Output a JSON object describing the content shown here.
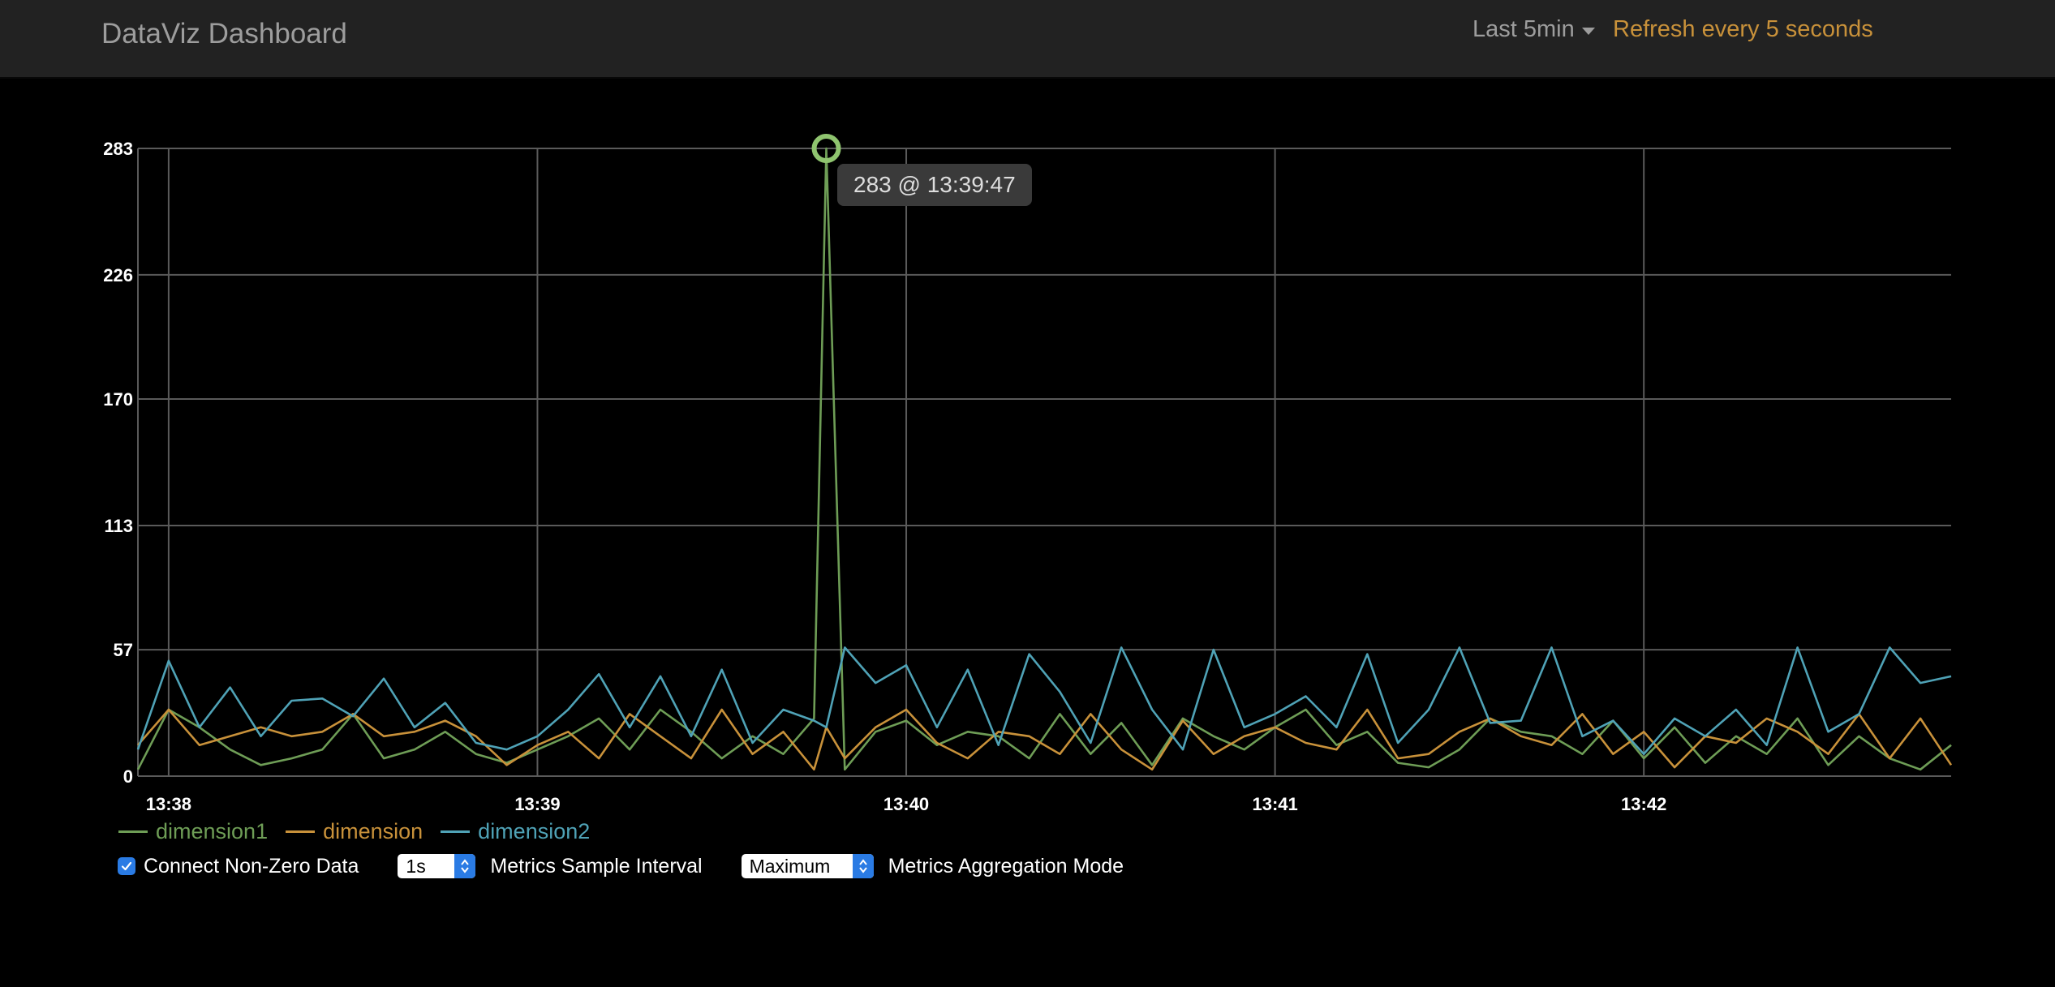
{
  "header": {
    "brand": "DataViz Dashboard",
    "range_label": "Last 5min",
    "refresh_label": "Refresh every 5 seconds"
  },
  "tooltip": {
    "text": "283 @ 13:39:47"
  },
  "controls": {
    "connect_label": "Connect Non-Zero Data",
    "connect_checked": true,
    "interval_value": "1s",
    "interval_label": "Metrics Sample Interval",
    "aggregation_value": "Maximum",
    "aggregation_label": "Metrics Aggregation Mode"
  },
  "colors": {
    "dimension1": "#6e9d56",
    "dimension": "#c8913a",
    "dimension2": "#4fa2b6",
    "grid": "#5a5a5a"
  },
  "chart_data": {
    "type": "line",
    "x_unit": "time (HH:MM:SS)",
    "xlim": [
      "13:37:55",
      "13:42:50"
    ],
    "ylim": [
      0,
      283
    ],
    "y_ticks": [
      0,
      57,
      113,
      170,
      226,
      283
    ],
    "x_ticks": [
      "13:38",
      "13:39",
      "13:40",
      "13:41",
      "13:42"
    ],
    "grid": true,
    "legend_position": "bottom-left",
    "highlight": {
      "series": "dimension1",
      "x": "13:39:47",
      "y": 283
    },
    "x": [
      "13:37:55",
      "13:38:00",
      "13:38:05",
      "13:38:10",
      "13:38:15",
      "13:38:20",
      "13:38:25",
      "13:38:30",
      "13:38:35",
      "13:38:40",
      "13:38:45",
      "13:38:50",
      "13:38:55",
      "13:39:00",
      "13:39:05",
      "13:39:10",
      "13:39:15",
      "13:39:20",
      "13:39:25",
      "13:39:30",
      "13:39:35",
      "13:39:40",
      "13:39:45",
      "13:39:47",
      "13:39:50",
      "13:39:55",
      "13:40:00",
      "13:40:05",
      "13:40:10",
      "13:40:15",
      "13:40:20",
      "13:40:25",
      "13:40:30",
      "13:40:35",
      "13:40:40",
      "13:40:45",
      "13:40:50",
      "13:40:55",
      "13:41:00",
      "13:41:05",
      "13:41:10",
      "13:41:15",
      "13:41:20",
      "13:41:25",
      "13:41:30",
      "13:41:35",
      "13:41:40",
      "13:41:45",
      "13:41:50",
      "13:41:55",
      "13:42:00",
      "13:42:05",
      "13:42:10",
      "13:42:15",
      "13:42:20",
      "13:42:25",
      "13:42:30",
      "13:42:35",
      "13:42:40",
      "13:42:45",
      "13:42:50"
    ],
    "series": [
      {
        "name": "dimension1",
        "values": [
          3,
          30,
          22,
          12,
          5,
          8,
          12,
          28,
          8,
          12,
          20,
          10,
          6,
          12,
          18,
          26,
          12,
          30,
          20,
          8,
          18,
          10,
          26,
          283,
          3,
          20,
          25,
          14,
          20,
          18,
          8,
          28,
          10,
          24,
          5,
          26,
          18,
          12,
          22,
          30,
          14,
          20,
          6,
          4,
          12,
          26,
          20,
          18,
          10,
          25,
          8,
          22,
          6,
          18,
          10,
          26,
          5,
          18,
          8,
          3,
          14
        ]
      },
      {
        "name": "dimension",
        "values": [
          14,
          30,
          14,
          18,
          22,
          18,
          20,
          28,
          18,
          20,
          25,
          18,
          5,
          14,
          20,
          8,
          28,
          18,
          8,
          30,
          10,
          20,
          3,
          22,
          8,
          22,
          30,
          15,
          8,
          20,
          18,
          10,
          28,
          12,
          3,
          25,
          10,
          18,
          22,
          15,
          12,
          30,
          8,
          10,
          20,
          26,
          18,
          14,
          28,
          10,
          20,
          4,
          18,
          15,
          26,
          20,
          10,
          28,
          8,
          26,
          5
        ]
      },
      {
        "name": "dimension2",
        "values": [
          12,
          52,
          22,
          40,
          18,
          34,
          35,
          27,
          44,
          22,
          33,
          15,
          12,
          18,
          30,
          46,
          22,
          45,
          18,
          48,
          15,
          30,
          25,
          22,
          58,
          42,
          50,
          22,
          48,
          14,
          55,
          38,
          15,
          58,
          30,
          12,
          57,
          22,
          28,
          36,
          22,
          55,
          15,
          30,
          58,
          24,
          25,
          58,
          18,
          25,
          10,
          26,
          18,
          30,
          14,
          58,
          20,
          28,
          58,
          42,
          45
        ]
      }
    ]
  }
}
